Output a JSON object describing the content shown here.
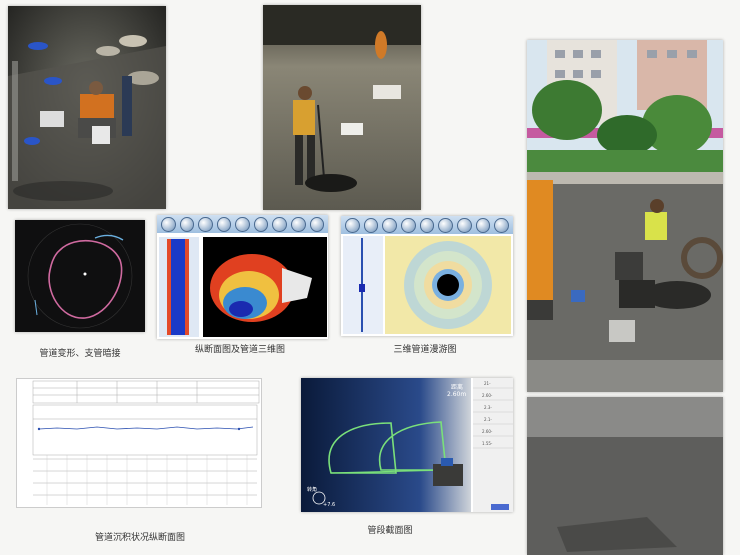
{
  "captions": {
    "pipe_deformation": "管道变形、支管暗接",
    "profile_3d": "纵断面图及管道三维图",
    "roaming_3d": "三维管道漫游图",
    "sediment_profile": "管道沉积状况纵断面图",
    "section_map": "管段截面图"
  },
  "readouts": {
    "distance_label": "距离",
    "distance_value": "2.60m",
    "angle_label": "转角",
    "angle_value": "+7.6",
    "table_values": [
      "21-",
      "2.60-",
      "2.3-",
      "2.1-",
      "2.60-",
      "1.55-"
    ]
  },
  "colors": {
    "sky": "#d9e6ef",
    "asphalt": "#3a3a3a",
    "vest": "#e07a20",
    "sonar_bg": "#111111",
    "accent_blue": "#2a4fb0"
  }
}
